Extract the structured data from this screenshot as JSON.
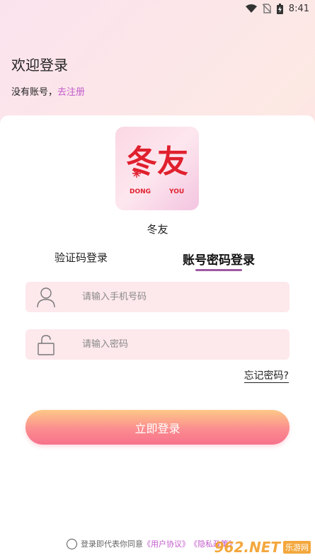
{
  "status_bar": {
    "time": "8:41",
    "icons": [
      "wifi-icon",
      "no-sim-icon",
      "battery-charging-icon"
    ]
  },
  "header": {
    "title": "欢迎登录",
    "register_prompt": "没有账号，",
    "register_link": "去注册"
  },
  "app": {
    "logo_text": "冬友",
    "logo_sub_left": "DONG",
    "logo_sub_right": "YOU",
    "name": "冬友"
  },
  "tabs": [
    {
      "label": "验证码登录",
      "active": false
    },
    {
      "label": "账号密码登录",
      "active": true
    }
  ],
  "form": {
    "phone_placeholder": "请输入手机号码",
    "phone_icon": "user-icon",
    "password_placeholder": "请输入密码",
    "password_icon": "lock-icon",
    "forgot_label": "忘记密码?",
    "login_label": "立即登录"
  },
  "agreement": {
    "prefix": "登录即代表你同意",
    "user_agreement": "《用户协议》",
    "privacy": "《隐私政策》"
  },
  "watermark": {
    "main": "962.NET",
    "sub": "乐游网"
  },
  "colors": {
    "accent_pink": "#c25bcc",
    "field_bg": "#fde8ec",
    "tab_underline": "#9c5aa0",
    "button_start": "#fdc887",
    "button_end": "#f7718c"
  }
}
